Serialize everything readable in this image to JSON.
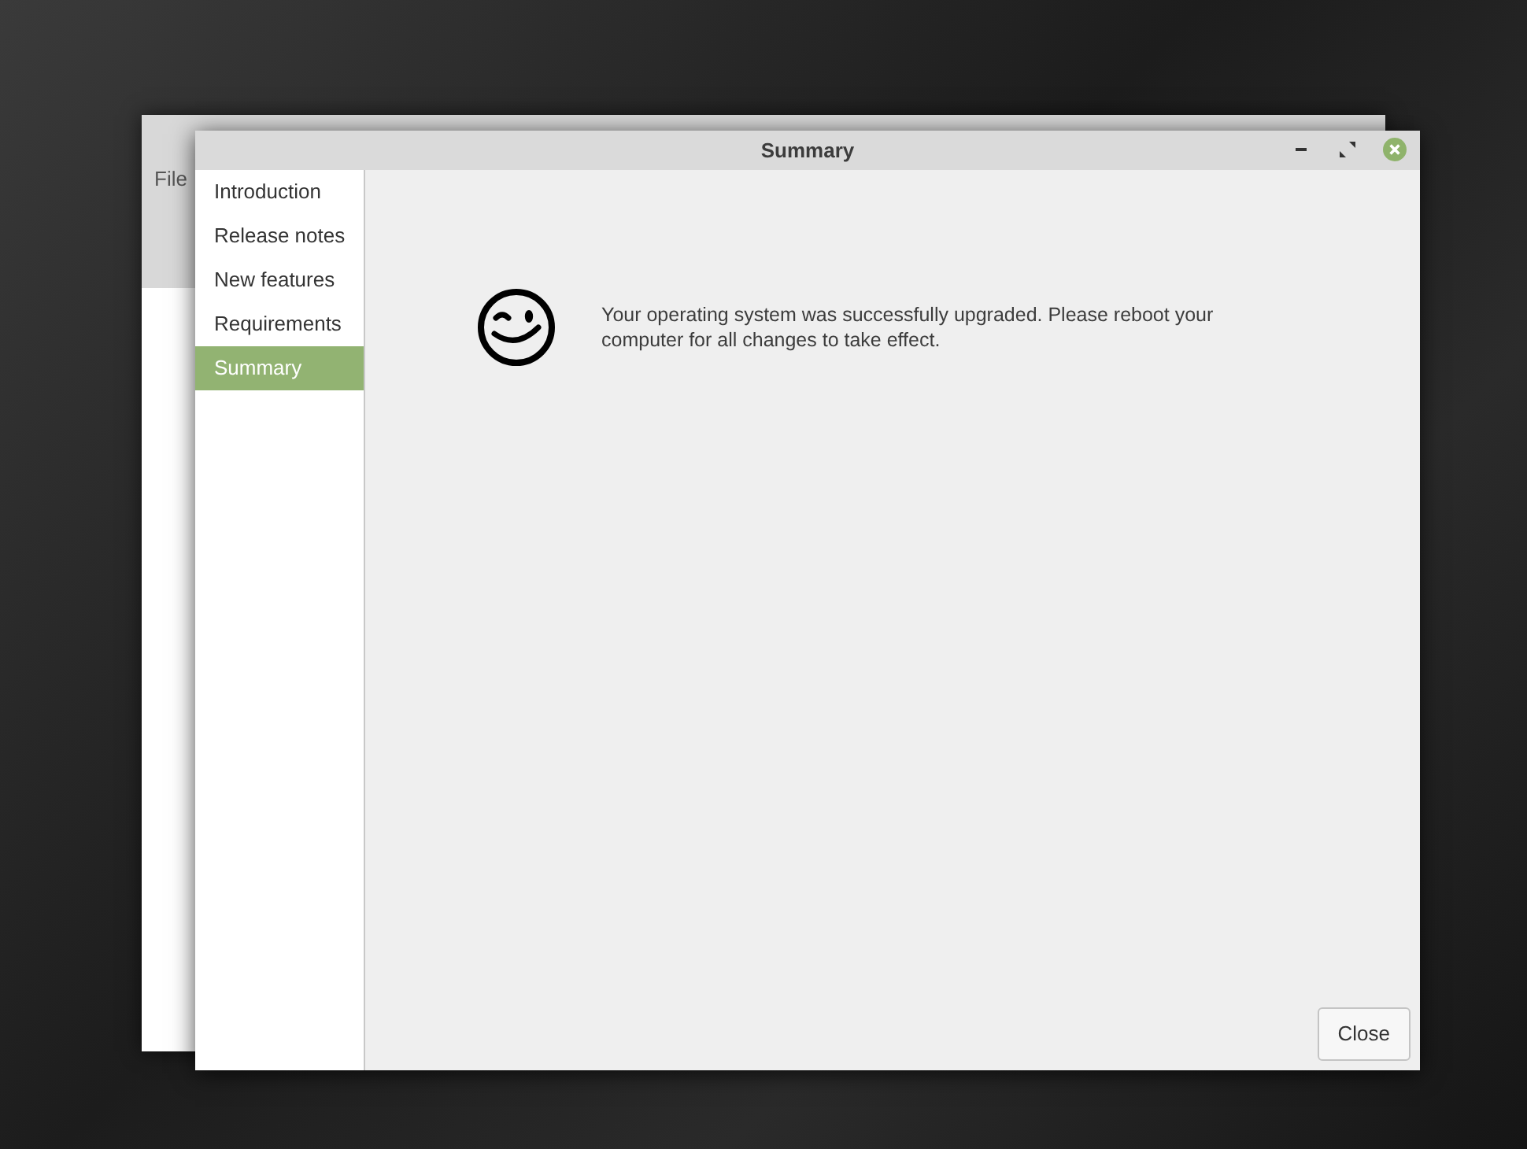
{
  "back_window": {
    "menu": [
      "File"
    ]
  },
  "window": {
    "title": "Summary"
  },
  "sidebar": {
    "items": [
      {
        "label": "Introduction",
        "selected": false
      },
      {
        "label": "Release notes",
        "selected": false
      },
      {
        "label": "New features",
        "selected": false
      },
      {
        "label": "Requirements",
        "selected": false
      },
      {
        "label": "Summary",
        "selected": true
      }
    ]
  },
  "message": "Your operating system was successfully upgraded. Please reboot your computer for all changes to take effect.",
  "buttons": [
    "Close"
  ]
}
